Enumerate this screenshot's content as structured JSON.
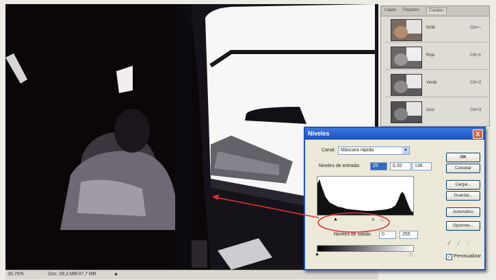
{
  "document": {
    "zoom": "30,76%",
    "doc_size": "Doc: 28,3 MB/37,7 MB"
  },
  "palette": {
    "tabs": [
      "Capas",
      "Trazados",
      "Canales"
    ],
    "channels": [
      {
        "name": "RGB",
        "shortcut": "Ctrl+~"
      },
      {
        "name": "Rojo",
        "shortcut": "Ctrl+1"
      },
      {
        "name": "Verde",
        "shortcut": "Ctrl+2"
      },
      {
        "name": "Azul",
        "shortcut": "Ctrl+3"
      }
    ]
  },
  "dialog": {
    "title": "Niveles",
    "close": "X",
    "channel_label": "Canal:",
    "channel_value": "Máscara rápida",
    "input_label": "Niveles de entrada:",
    "input_values": [
      "25",
      "0,32",
      "136"
    ],
    "output_label": "Niveles de salida:",
    "output_values": [
      "0",
      "255"
    ],
    "buttons": [
      "OK",
      "Cancelar",
      "Cargar...",
      "Guardar...",
      "Automático",
      "Opciones..."
    ],
    "preview_label": "Previsualizar",
    "preview_checked": true
  }
}
